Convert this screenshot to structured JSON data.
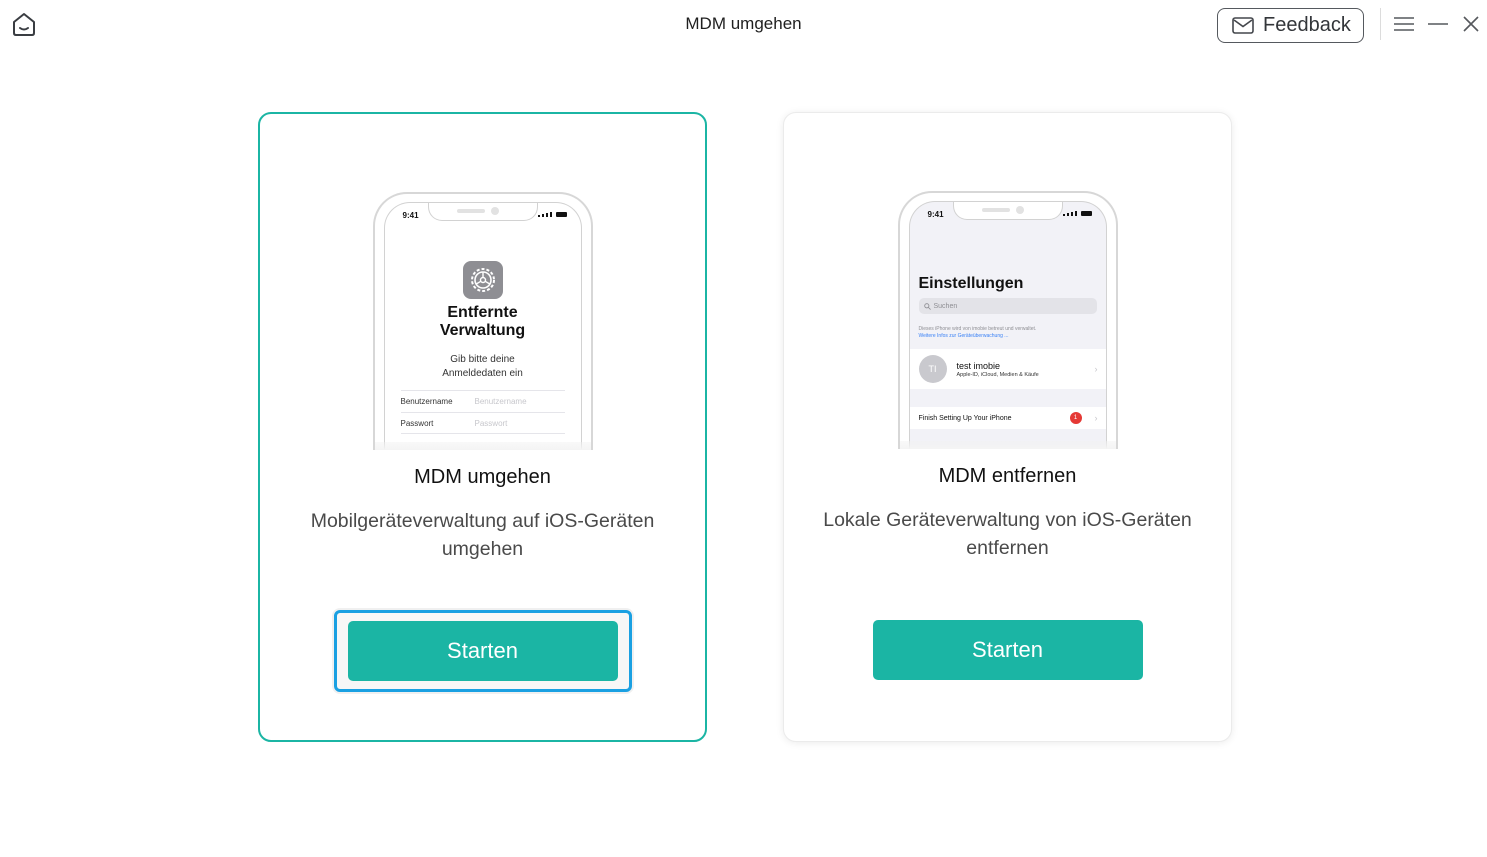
{
  "window": {
    "title": "MDM umgehen",
    "feedback_label": "Feedback"
  },
  "cards": [
    {
      "title": "MDM umgehen",
      "description": "Mobilgeräteverwaltung auf iOS-Geräten umgehen",
      "button_label": "Starten",
      "selected": true,
      "phone": {
        "time": "9:41",
        "heading_line1": "Entfernte",
        "heading_line2": "Verwaltung",
        "subtitle_line1": "Gib bitte deine",
        "subtitle_line2": "Anmeldedaten ein",
        "username_label": "Benutzername",
        "username_placeholder": "Benutzername",
        "password_label": "Passwort",
        "password_placeholder": "Passwort"
      }
    },
    {
      "title": "MDM entfernen",
      "description": "Lokale Geräteverwaltung von iOS-Geräten entfernen",
      "button_label": "Starten",
      "selected": false,
      "phone": {
        "time": "9:41",
        "heading": "Einstellungen",
        "search_placeholder": "Suchen",
        "note_line1": "Dieses iPhone wird von imobie betreut und verwaltet.",
        "note_link": "Weitere Infos zur Geräteüberwachung ...",
        "account_initials": "TI",
        "account_name": "test imobie",
        "account_sub": "Apple-ID, iCloud, Medien & Käufe",
        "finish_label": "Finish Setting Up Your iPhone",
        "finish_badge": "1"
      }
    }
  ],
  "colors": {
    "accent": "#1bb5a4",
    "focus": "#1aa0e2"
  }
}
